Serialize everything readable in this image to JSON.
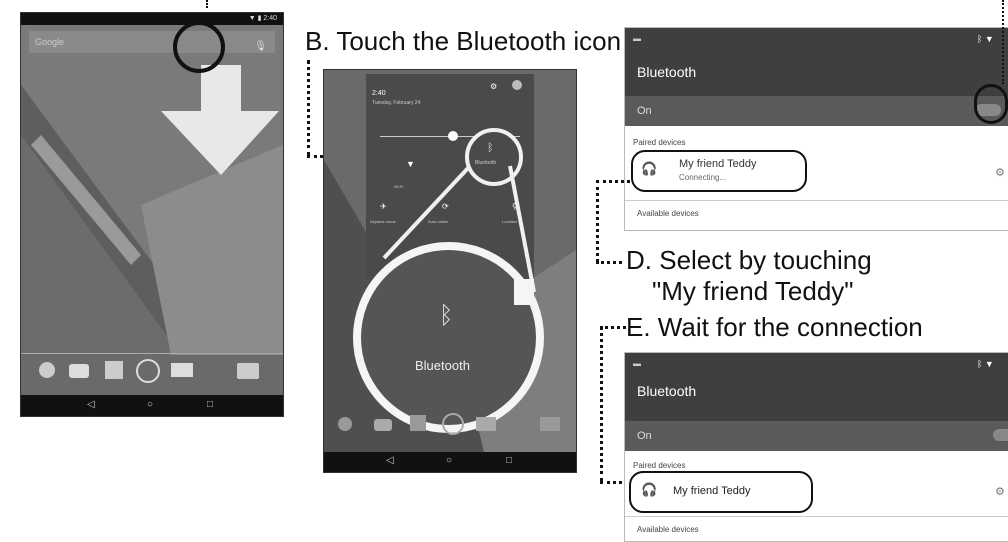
{
  "steps": {
    "b": "B. Touch the Bluetooth icon",
    "d_line1": "D. Select by touching",
    "d_line2": "\"My friend Teddy\"",
    "e": "E. Wait for the connection"
  },
  "home_screen": {
    "search_text": "Google",
    "nav": [
      "◁",
      "○",
      "□"
    ]
  },
  "quick_settings": {
    "time": "2:40",
    "date": "Tuesday, February 24",
    "wifi_label": "Wi-Fi",
    "bluetooth_label": "Bluetooth",
    "airplane_label": "Airplane mode",
    "rotate_label": "Auto-rotate",
    "location_label": "Location",
    "zoom_label": "Bluetooth",
    "nav": [
      "◁",
      "○",
      "□"
    ]
  },
  "settings_c": {
    "title": "Bluetooth",
    "toggle_label": "On",
    "paired_header": "Paired devices",
    "device_name": "My friend Teddy",
    "device_status": "Connecting...",
    "available_header": "Available devices"
  },
  "settings_e": {
    "title": "Bluetooth",
    "toggle_label": "On",
    "paired_header": "Paired devices",
    "device_name": "My friend Teddy",
    "available_header": "Available devices"
  }
}
